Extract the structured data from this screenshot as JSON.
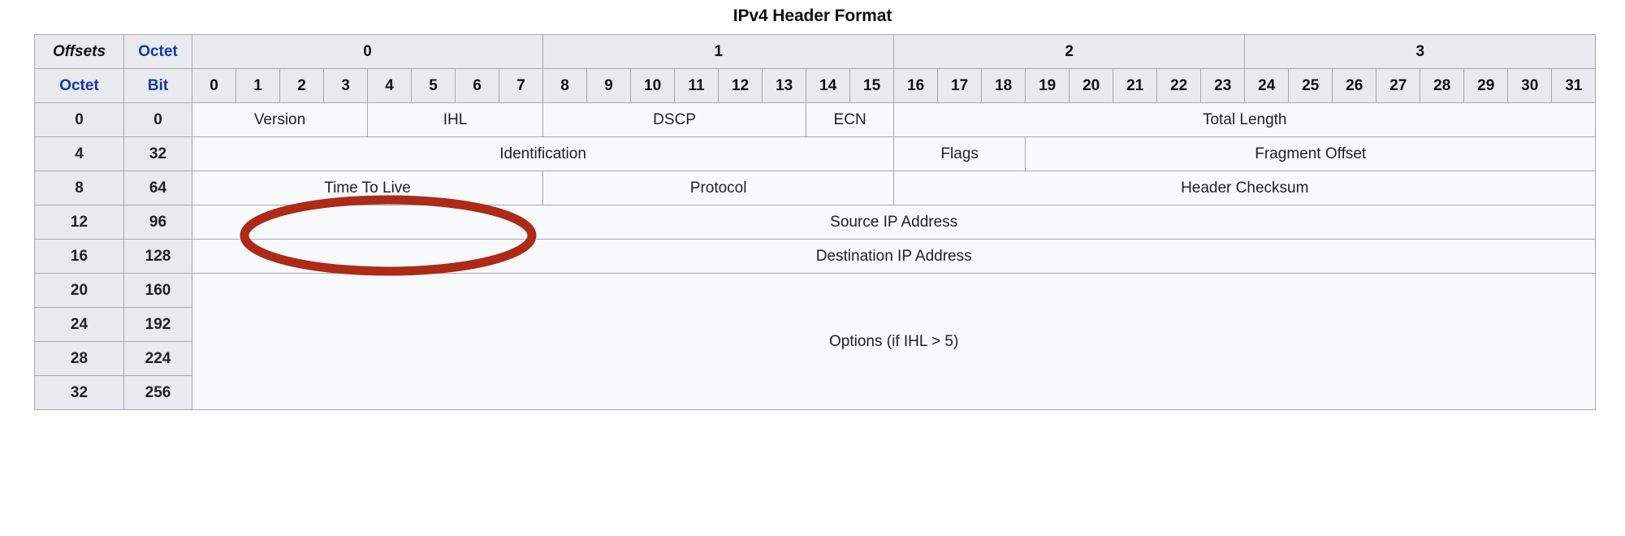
{
  "title": "IPv4 Header Format",
  "table": {
    "corner_labels": {
      "offsets": "Offsets",
      "octet_top": "Octet",
      "octet_left": "Octet",
      "bit": "Bit"
    },
    "octet_groups": [
      "0",
      "1",
      "2",
      "3"
    ],
    "bit_numbers": [
      "0",
      "1",
      "2",
      "3",
      "4",
      "5",
      "6",
      "7",
      "8",
      "9",
      "10",
      "11",
      "12",
      "13",
      "14",
      "15",
      "16",
      "17",
      "18",
      "19",
      "20",
      "21",
      "22",
      "23",
      "24",
      "25",
      "26",
      "27",
      "28",
      "29",
      "30",
      "31"
    ],
    "row_offsets": [
      {
        "octet": "0",
        "bit": "0"
      },
      {
        "octet": "4",
        "bit": "32"
      },
      {
        "octet": "8",
        "bit": "64"
      },
      {
        "octet": "12",
        "bit": "96"
      },
      {
        "octet": "16",
        "bit": "128"
      },
      {
        "octet": "20",
        "bit": "160"
      },
      {
        "octet": "24",
        "bit": "192"
      },
      {
        "octet": "28",
        "bit": "224"
      },
      {
        "octet": "32",
        "bit": "256"
      }
    ],
    "fields": {
      "version": "Version",
      "ihl": "IHL",
      "dscp": "DSCP",
      "ecn": "ECN",
      "total_length": "Total Length",
      "identification": "Identification",
      "flags": "Flags",
      "fragment_offset": "Fragment Offset",
      "time_to_live": "Time To Live",
      "protocol": "Protocol",
      "header_checksum": "Header Checksum",
      "source_ip": "Source IP Address",
      "destination_ip": "Destination IP Address",
      "options_link": "Options",
      "options_condition": "(if IHL > 5)"
    }
  },
  "annotation": {
    "shape": "ellipse",
    "target_field": "Time To Live",
    "color": "#ad2a18",
    "stroke_width": 11
  },
  "colors": {
    "link_blue": "#1338a8",
    "header_bg": "#e8eaee",
    "cell_bg": "#f8f9fa",
    "border": "#a2a9b1",
    "text": "#202122",
    "annotation_red": "#ad2a18"
  }
}
